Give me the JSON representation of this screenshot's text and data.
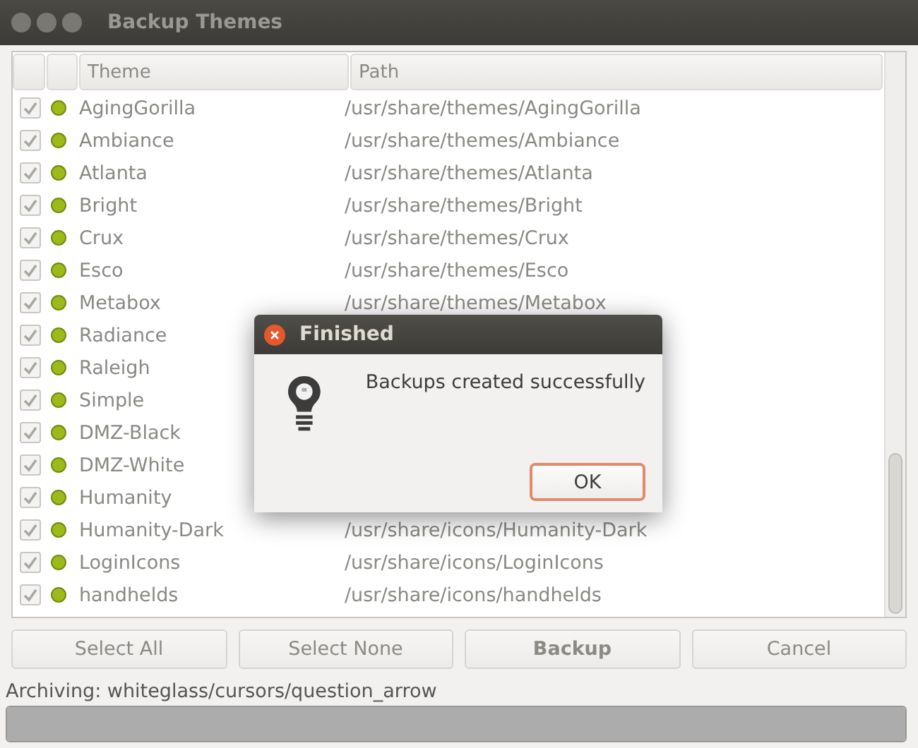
{
  "window": {
    "title": "Backup Themes"
  },
  "table": {
    "columns": [
      "Theme",
      "Path"
    ],
    "rows": [
      {
        "checked": true,
        "theme": "AgingGorilla",
        "path": "/usr/share/themes/AgingGorilla"
      },
      {
        "checked": true,
        "theme": "Ambiance",
        "path": "/usr/share/themes/Ambiance"
      },
      {
        "checked": true,
        "theme": "Atlanta",
        "path": "/usr/share/themes/Atlanta"
      },
      {
        "checked": true,
        "theme": "Bright",
        "path": "/usr/share/themes/Bright"
      },
      {
        "checked": true,
        "theme": "Crux",
        "path": "/usr/share/themes/Crux"
      },
      {
        "checked": true,
        "theme": "Esco",
        "path": "/usr/share/themes/Esco"
      },
      {
        "checked": true,
        "theme": "Metabox",
        "path": "/usr/share/themes/Metabox"
      },
      {
        "checked": true,
        "theme": "Radiance"
      },
      {
        "checked": true,
        "theme": "Raleigh"
      },
      {
        "checked": true,
        "theme": "Simple"
      },
      {
        "checked": true,
        "theme": "DMZ-Black"
      },
      {
        "checked": true,
        "theme": "DMZ-White"
      },
      {
        "checked": true,
        "theme": "Humanity"
      },
      {
        "checked": true,
        "theme": "Humanity-Dark",
        "path": "/usr/share/icons/Humanity-Dark"
      },
      {
        "checked": true,
        "theme": "LoginIcons",
        "path": "/usr/share/icons/LoginIcons"
      },
      {
        "checked": true,
        "theme": "handhelds",
        "path": "/usr/share/icons/handhelds"
      }
    ]
  },
  "buttons": [
    {
      "label": "Select All",
      "disabled": true,
      "default": false
    },
    {
      "label": "Select None",
      "disabled": true,
      "default": false
    },
    {
      "label": "Backup",
      "disabled": true,
      "default": true
    },
    {
      "label": "Cancel",
      "disabled": true,
      "default": false
    }
  ],
  "status": "Archiving: whiteglass/cursors/question_arrow",
  "progress": {
    "level": 1
  },
  "dialog": {
    "title": "Finished",
    "message": "Backups created successfully",
    "button": "OK"
  }
}
